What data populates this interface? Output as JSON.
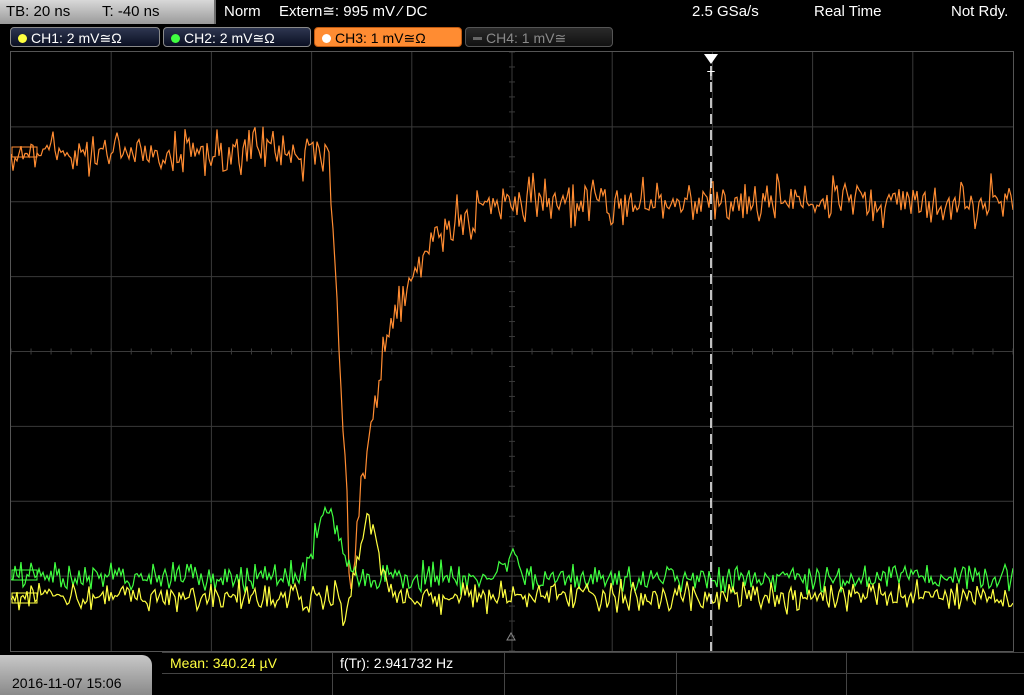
{
  "topbar": {
    "timebase": "TB: 20 ns",
    "trigger_pos": "T: -40 ns",
    "mode": "Norm",
    "trigger": "Extern≅: 995 mV ⁄ DC",
    "sample_rate": "2.5 GSa/s",
    "acq_mode": "Real Time",
    "status": "Not Rdy."
  },
  "channels": [
    {
      "label": "CH1: 2 mV≅Ω",
      "color": "#ffff40",
      "state": "on"
    },
    {
      "label": "CH2: 2 mV≅Ω",
      "color": "#40ff40",
      "state": "on"
    },
    {
      "label": "CH3: 1 mV≅Ω",
      "color": "#ff8c32",
      "state": "active"
    },
    {
      "label": "CH4: 1 mV≅",
      "color": "#8a8a8a",
      "state": "off"
    }
  ],
  "trigger_marker": "T",
  "colors": {
    "ch1": "#ffff40",
    "ch2": "#40ff40",
    "ch3": "#ff8c32",
    "grid": "#3a3a3a"
  },
  "bottom": {
    "date": "2016-11-07 15:06",
    "mean": "Mean: 340.24 µV",
    "freq": "f(Tr): 2.941732 Hz"
  }
}
